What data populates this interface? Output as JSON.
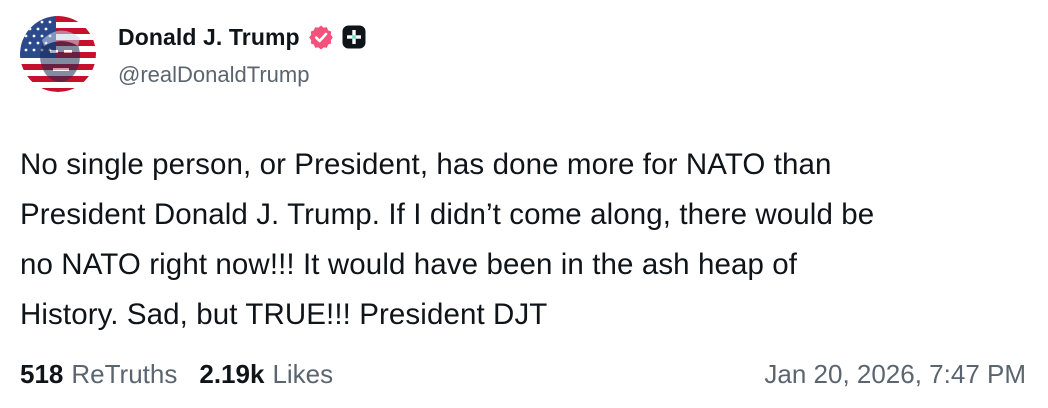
{
  "author": {
    "display_name": "Donald J. Trump",
    "handle": "@realDonaldTrump",
    "verified_badge_color": "#f4517c",
    "avatar_icon": "flag-portrait-avatar",
    "plus_badge_icon": "truth-social-plus-icon"
  },
  "post": {
    "lines": [
      "No single person, or President, has done more for NATO than",
      "President Donald J. Trump. If I didn’t come along, there would be",
      "no NATO right now!!! It would have been in the ash heap of",
      "History. Sad, but TRUE!!! President DJT"
    ]
  },
  "stats": {
    "retruths_count": "518",
    "retruths_label": "ReTruths",
    "likes_count": "2.19k",
    "likes_label": "Likes"
  },
  "timestamp": "Jan 20, 2026, 7:47 PM"
}
